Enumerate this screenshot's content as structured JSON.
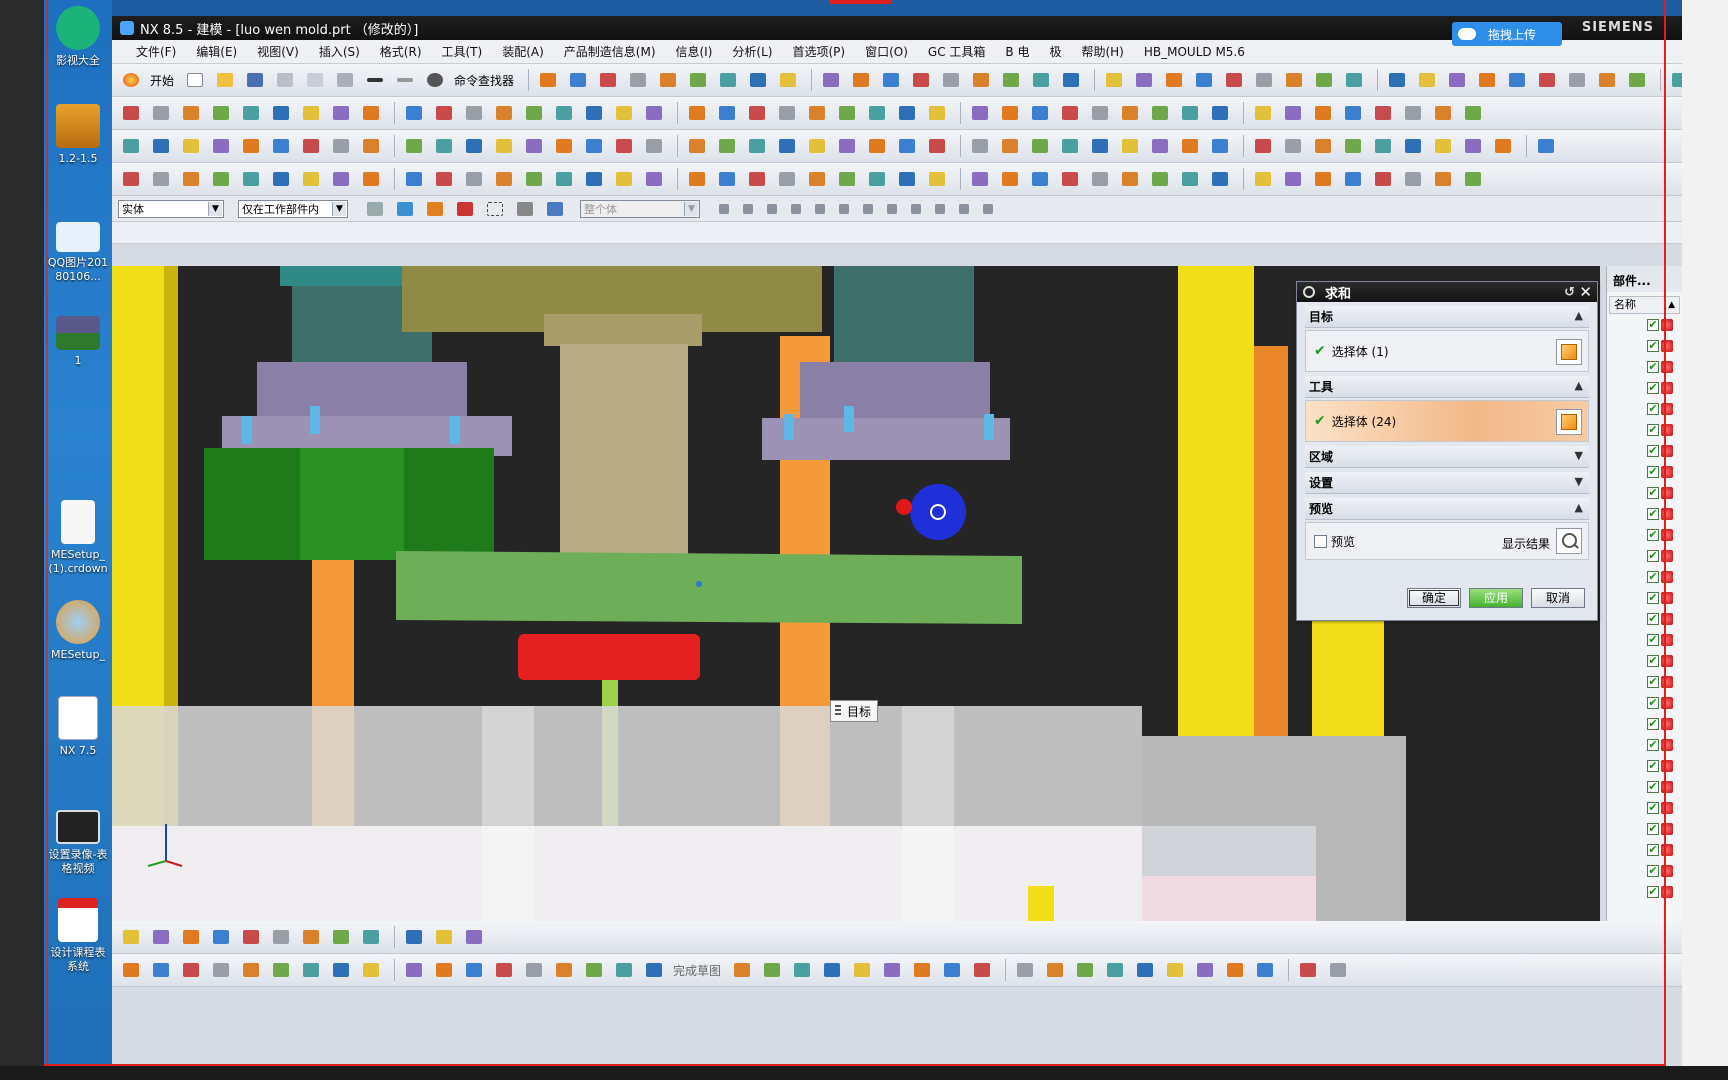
{
  "desktop": {
    "icons": [
      {
        "label": "影视大全"
      },
      {
        "label": "1.2-1.5"
      },
      {
        "label": "QQ图片20180106..."
      },
      {
        "label": "1"
      },
      {
        "label": "MESetup_(1).crdown"
      },
      {
        "label": "MESetup_"
      },
      {
        "label": "NX 7.5"
      },
      {
        "label": "设置录像-表格视频"
      },
      {
        "label": "设计课程表系统"
      }
    ]
  },
  "window": {
    "title": "NX 8.5 - 建模 - [luo wen mold.prt （修改的）]",
    "brand": "SIEMENS",
    "upload_button": "拖拽上传"
  },
  "menu": [
    "文件(F)",
    "编辑(E)",
    "视图(V)",
    "插入(S)",
    "格式(R)",
    "工具(T)",
    "装配(A)",
    "产品制造信息(M)",
    "信息(I)",
    "分析(L)",
    "首选项(P)",
    "窗口(O)",
    "GC 工具箱",
    "B 电",
    "极",
    "帮助(H)",
    "HB_MOULD M5.6"
  ],
  "toolbar": {
    "start_label": "开始",
    "command_finder_label": "命令查找器"
  },
  "filterbar": {
    "type_filter": "实体",
    "scope_filter": "仅在工作部件内",
    "assembly_filter": "整个体"
  },
  "viewport": {
    "tooltip": "目标"
  },
  "dialog": {
    "title": "求和",
    "target_section": "目标",
    "target_select": "选择体 (1)",
    "tool_section": "工具",
    "tool_select": "选择体 (24)",
    "region_section": "区域",
    "settings_section": "设置",
    "preview_section": "预览",
    "preview_checkbox": "预览",
    "show_result": "显示结果",
    "ok_button": "确定",
    "apply_button": "应用",
    "cancel_button": "取消"
  },
  "navigator": {
    "title": "部件...",
    "column_name": "名称"
  },
  "bottombar": {
    "finish_sketch_label": "完成草图"
  },
  "colors": {
    "viewport_bg": "#2a2a2a",
    "yellow_pin": "#f5e21a",
    "orange_pin": "#f59a3a",
    "green_plate": "#6fae58",
    "red_part": "#e52020",
    "lavender_flange": "#8a7fa6",
    "dark_green_block": "#1f7a1a",
    "accent_orange": "#f3b887"
  }
}
